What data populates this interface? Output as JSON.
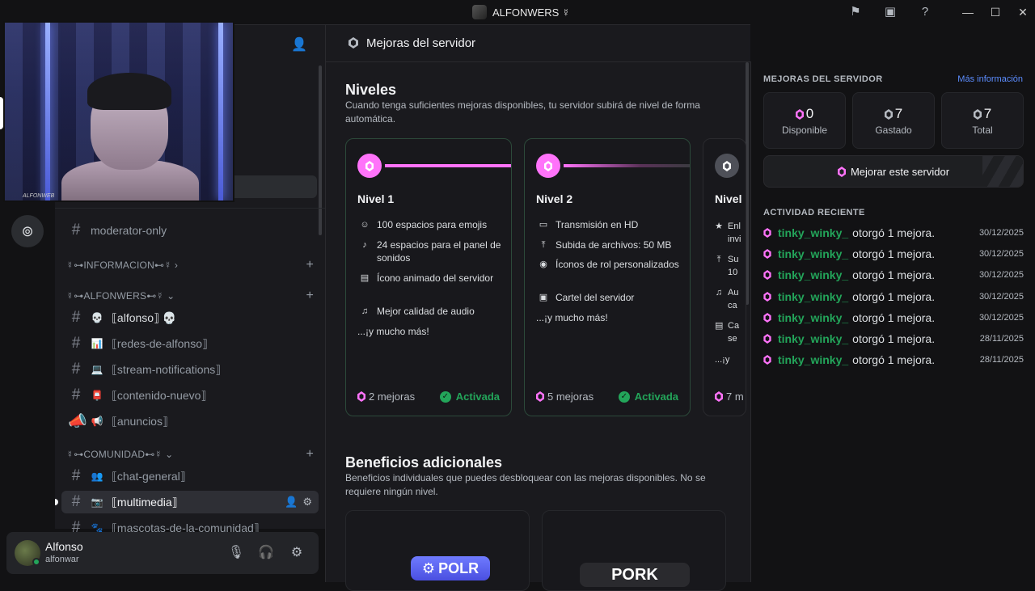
{
  "titlebar": {
    "title": "ALFONWERS ☿"
  },
  "channels": {
    "moderator_only": "moderator-only",
    "categories": [
      {
        "name": "☿⊶INFORMACION⊷☿ ›"
      },
      {
        "name": "☿⊶ALFONWERS⊷☿ ⌄"
      },
      {
        "name": "☿⊶COMUNIDAD⊷☿ ⌄"
      }
    ],
    "items": [
      {
        "emoji": "💀",
        "label": "⟦alfonso⟧ 💀"
      },
      {
        "emoji": "📊",
        "label": "⟦redes-de-alfonso⟧"
      },
      {
        "emoji": "💻",
        "label": "⟦stream-notifications⟧"
      },
      {
        "emoji": "📮",
        "label": "⟦contenido-nuevo⟧"
      },
      {
        "emoji": "📢",
        "label": "⟦anuncios⟧"
      },
      {
        "emoji": "👥",
        "label": "⟦chat-general⟧"
      },
      {
        "emoji": "📷",
        "label": "⟦multimedia⟧"
      },
      {
        "emoji": "🐾",
        "label": "⟦mascotas-de-la-comunidad⟧"
      }
    ],
    "webcam_watermark": "ALFONWEB"
  },
  "user": {
    "name": "Alfonso",
    "tag": "alfonwar"
  },
  "main": {
    "header": "Mejoras del servidor",
    "levels_title": "Niveles",
    "levels_desc": "Cuando tenga suficientes mejoras disponibles, tu servidor subirá de nivel de forma automática.",
    "tiers": [
      {
        "name": "Nivel 1",
        "perks": [
          "100 espacios para emojis",
          "24 espacios para el panel de sonidos",
          "Ícono animado del servidor",
          "Mejor calidad de audio",
          "...¡y mucho más!"
        ],
        "boosts": "2 mejoras",
        "status": "Activada"
      },
      {
        "name": "Nivel 2",
        "perks": [
          "Transmisión en HD",
          "Subida de archivos: 50 MB",
          "Íconos de rol personalizados",
          "Cartel del servidor",
          "...¡y mucho más!"
        ],
        "boosts": "5 mejoras",
        "status": "Activada"
      },
      {
        "name": "Nivel",
        "perks": [
          "Enl invi",
          "Su 10",
          "Au ca",
          "Ca se",
          "...¡y"
        ],
        "boosts": "7 m"
      }
    ],
    "extra_title": "Beneficios adicionales",
    "extra_desc": "Beneficios individuales que puedes desbloquear con las mejoras disponibles. No se requiere ningún nivel.",
    "cards": [
      {
        "logo": "POLR"
      },
      {
        "logo": "PORK"
      }
    ]
  },
  "sidebar": {
    "heading": "MEJORAS DEL SERVIDOR",
    "more_info": "Más información",
    "stats": [
      {
        "value": "0",
        "label": "Disponible"
      },
      {
        "value": "7",
        "label": "Gastado"
      },
      {
        "value": "7",
        "label": "Total"
      }
    ],
    "boost_button": "Mejorar este servidor",
    "activity_heading": "ACTIVIDAD RECIENTE",
    "activity": [
      {
        "user": "tinky_winky_",
        "action": "otorgó 1 mejora.",
        "date": "30/12/2025"
      },
      {
        "user": "tinky_winky_",
        "action": "otorgó 1 mejora.",
        "date": "30/12/2025"
      },
      {
        "user": "tinky_winky_",
        "action": "otorgó 1 mejora.",
        "date": "30/12/2025"
      },
      {
        "user": "tinky_winky_",
        "action": "otorgó 1 mejora.",
        "date": "30/12/2025"
      },
      {
        "user": "tinky_winky_",
        "action": "otorgó 1 mejora.",
        "date": "30/12/2025"
      },
      {
        "user": "tinky_winky_",
        "action": "otorgó 1 mejora.",
        "date": "28/11/2025"
      },
      {
        "user": "tinky_winky_",
        "action": "otorgó 1 mejora.",
        "date": "28/11/2025"
      }
    ]
  },
  "colors": {
    "boost_pink": "#ff73fa",
    "green": "#23a55a",
    "link": "#5c8dff"
  }
}
